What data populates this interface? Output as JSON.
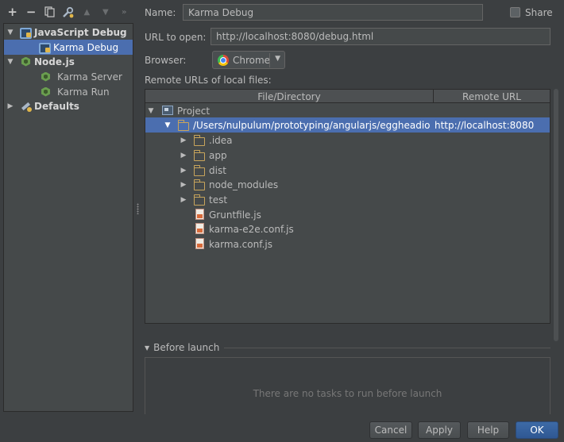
{
  "toolbar": {
    "add": "+",
    "remove": "−",
    "more": "»"
  },
  "config_tree": {
    "items": [
      {
        "label": "JavaScript Debug",
        "bold": true
      },
      {
        "label": "Karma Debug",
        "selected": true
      },
      {
        "label": "Node.js",
        "bold": true
      },
      {
        "label": "Karma Server"
      },
      {
        "label": "Karma Run"
      },
      {
        "label": "Defaults",
        "bold": true
      }
    ]
  },
  "form": {
    "name_label": "Name:",
    "name_value": "Karma Debug",
    "share_label": "Share",
    "url_label": "URL to open:",
    "url_value": "http://localhost:8080/debug.html",
    "browser_label": "Browser:",
    "browser_value": "Chrome",
    "remote_label": "Remote URLs of local files:"
  },
  "mapping_table": {
    "headers": [
      "File/Directory",
      "Remote URL"
    ],
    "rows": [
      {
        "name": "Project",
        "remote": ""
      },
      {
        "name": "/Users/nulpulum/prototyping/angularjs/eggheadio",
        "remote": "http://localhost:8080"
      },
      {
        "name": ".idea",
        "remote": ""
      },
      {
        "name": "app",
        "remote": ""
      },
      {
        "name": "dist",
        "remote": ""
      },
      {
        "name": "node_modules",
        "remote": ""
      },
      {
        "name": "test",
        "remote": ""
      },
      {
        "name": "Gruntfile.js",
        "remote": ""
      },
      {
        "name": "karma-e2e.conf.js",
        "remote": ""
      },
      {
        "name": "karma.conf.js",
        "remote": ""
      }
    ]
  },
  "before_launch": {
    "title": "Before launch",
    "empty_text": "There are no tasks to run before launch"
  },
  "buttons": {
    "cancel": "Cancel",
    "apply": "Apply",
    "help": "Help",
    "ok": "OK"
  },
  "colors": {
    "background": "#3c3f41",
    "selection": "#4b6eaf",
    "field": "#45494a"
  }
}
